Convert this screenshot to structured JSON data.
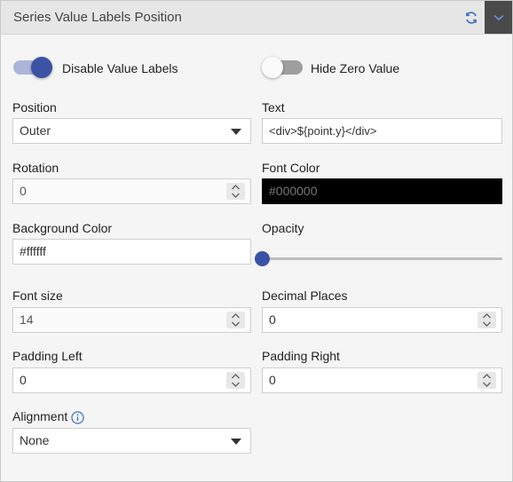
{
  "header": {
    "title": "Series Value Labels Position",
    "refresh_icon": "refresh-icon",
    "collapse_icon": "chevron-down-icon"
  },
  "toggles": {
    "disable_value_labels": {
      "label": "Disable Value Labels",
      "on": true
    },
    "hide_zero_value": {
      "label": "Hide Zero Value",
      "on": false
    }
  },
  "fields": {
    "position": {
      "label": "Position",
      "value": "Outer",
      "type": "select"
    },
    "text": {
      "label": "Text",
      "value": "<div>${point.y}</div>"
    },
    "rotation": {
      "label": "Rotation",
      "value": "0"
    },
    "font_color": {
      "label": "Font Color",
      "value": "#000000"
    },
    "background_color": {
      "label": "Background Color",
      "value": "#ffffff"
    },
    "opacity": {
      "label": "Opacity",
      "value_fraction": 0
    },
    "font_size": {
      "label": "Font size",
      "value": "14"
    },
    "decimal_places": {
      "label": "Decimal Places",
      "value": "0"
    },
    "padding_left": {
      "label": "Padding Left",
      "value": "0"
    },
    "padding_right": {
      "label": "Padding Right",
      "value": "0"
    },
    "alignment": {
      "label": "Alignment",
      "value": "None",
      "info_icon": "info-icon"
    }
  },
  "colors": {
    "accent": "#3a53a4",
    "toggle_on_track": "#aab5d8",
    "toggle_off_track": "#9e9e9e",
    "font_color_swatch": "#000000",
    "header_bg": "#e6e6e6",
    "collapse_bg": "#4a4a4a"
  }
}
